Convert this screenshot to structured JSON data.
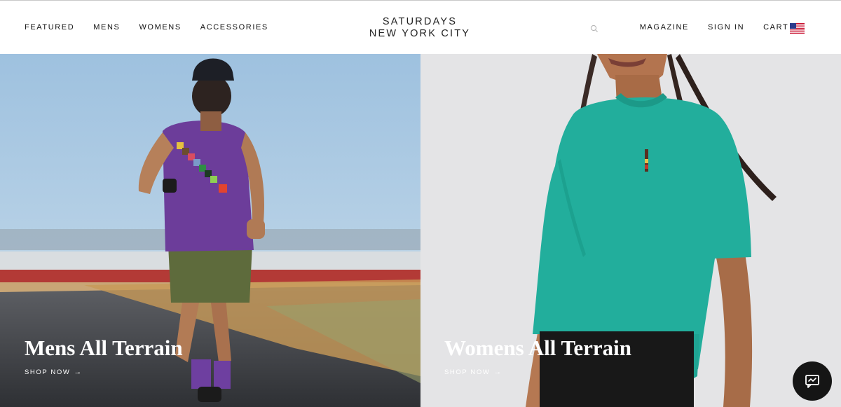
{
  "header": {
    "nav_left": [
      "FEATURED",
      "MENS",
      "WOMENS",
      "ACCESSORIES"
    ],
    "logo_line1": "SATURDAYS",
    "logo_line2": "NEW YORK CITY",
    "nav_right": {
      "magazine": "MAGAZINE",
      "sign_in": "SIGN IN",
      "cart": "CART (0)"
    },
    "search_icon": "search-icon",
    "flag_icon": "us-flag-icon"
  },
  "heroes": [
    {
      "title": "Mens All Terrain",
      "cta": "SHOP NOW",
      "cta_arrow": "→"
    },
    {
      "title": "Womens All Terrain",
      "cta": "SHOP NOW",
      "cta_arrow": "→"
    }
  ],
  "chat": {
    "icon": "chat-icon"
  },
  "colors": {
    "sky": "#a6c6e2",
    "tank_top": "#6c3d9a",
    "shorts": "#5e6b3c",
    "tee": "#22ae9c",
    "right_background": "#e4e4e6",
    "chat_button": "#151515"
  }
}
